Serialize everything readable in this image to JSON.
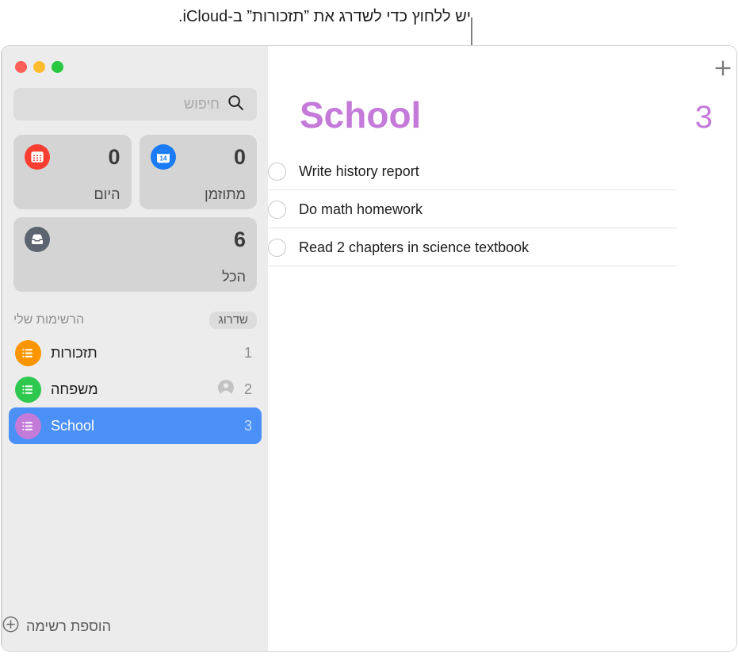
{
  "callout": {
    "caption": "יש ללחוץ כדי לשדרג את ”תזכורות” ב-iCloud."
  },
  "window": {
    "traffic_lights": [
      {
        "name": "close-button",
        "color": "#ff5f57"
      },
      {
        "name": "minimize-button",
        "color": "#febc2e"
      },
      {
        "name": "zoom-button",
        "color": "#28c840"
      }
    ]
  },
  "sidebar": {
    "search": {
      "placeholder": "חיפוש",
      "value": "",
      "icon": "search-icon"
    },
    "smart_lists": [
      {
        "id": "scheduled",
        "label": "מתוזמן",
        "count": "0",
        "icon": "calendar-day-icon",
        "icon_color": "#1b7bf5",
        "calendar_day": "14",
        "full_width": false
      },
      {
        "id": "today",
        "label": "היום",
        "count": "0",
        "icon": "calendar-icon",
        "icon_color": "#f93e31",
        "full_width": false
      },
      {
        "id": "all",
        "label": "הכל",
        "count": "6",
        "icon": "inbox-tray-icon",
        "icon_color": "#5c6470",
        "full_width": true
      }
    ],
    "lists_section": {
      "title": "הרשימות שלי",
      "upgrade_badge": "שדרוג",
      "items": [
        {
          "name": "תזכורות",
          "count": "1",
          "color": "#fa9500",
          "icon": "list-bullets-icon",
          "shared": false,
          "selected": false
        },
        {
          "name": "משפחה",
          "count": "2",
          "color": "#2fc84f",
          "icon": "list-bullets-icon",
          "shared": true,
          "shared_icon": "person-circle-icon",
          "selected": false
        },
        {
          "name": "School",
          "count": "3",
          "color": "#c47ad8",
          "icon": "list-bullets-icon",
          "shared": false,
          "selected": true
        }
      ]
    },
    "add_list": {
      "label": "הוספת רשימה",
      "icon": "plus-circle-icon"
    }
  },
  "main": {
    "add_reminder_icon": "plus-icon",
    "list_title": "School",
    "list_title_count": "3",
    "list_accent": "#c47ad8",
    "tasks": [
      {
        "text": "Write history report",
        "completed": false
      },
      {
        "text": "Do math homework",
        "completed": false
      },
      {
        "text": "Read 2 chapters in science textbook",
        "completed": false
      }
    ]
  }
}
